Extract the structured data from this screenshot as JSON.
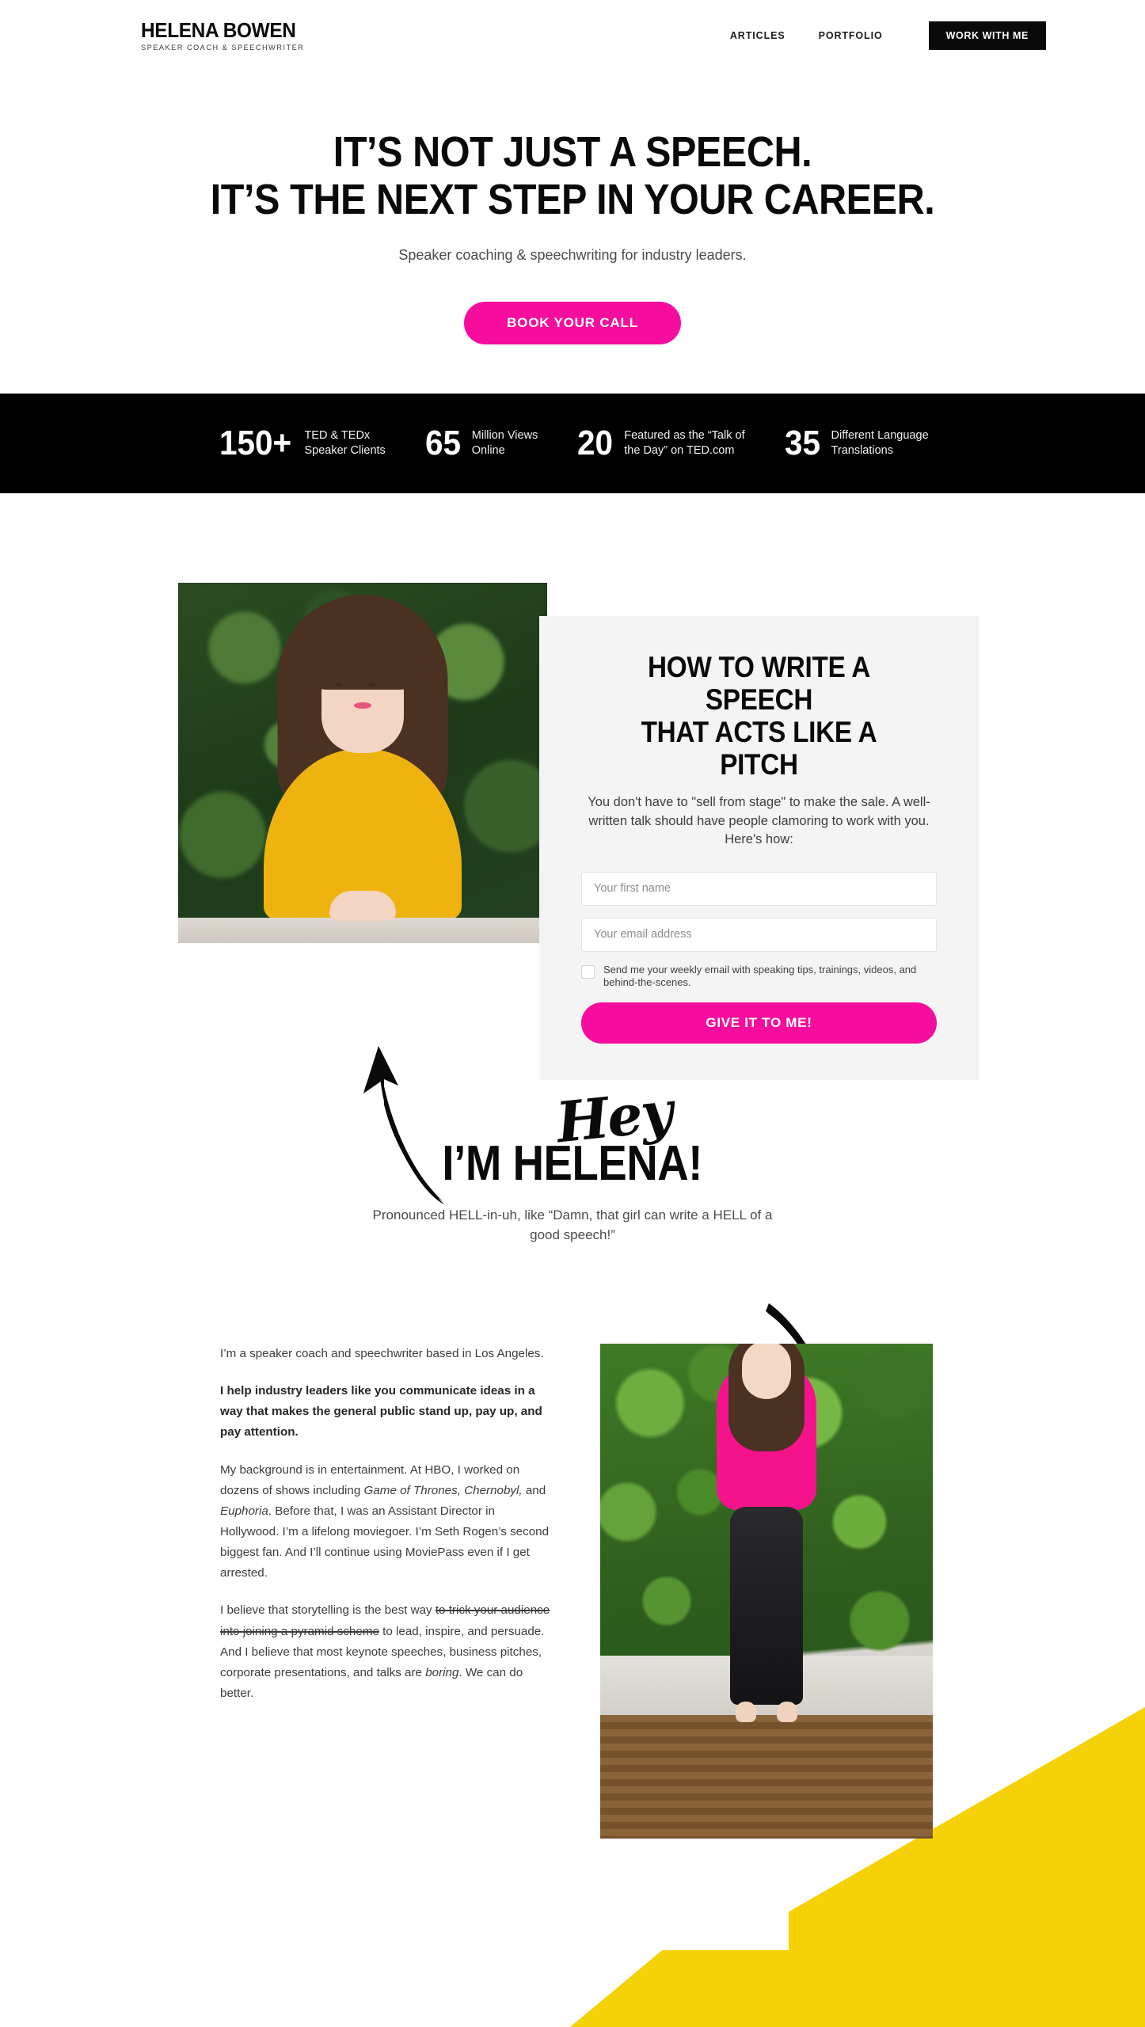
{
  "header": {
    "logo_name": "HELENA BOWEN",
    "logo_tagline": "SPEAKER COACH & SPEECHWRITER",
    "nav": [
      {
        "label": "ARTICLES"
      },
      {
        "label": "PORTFOLIO"
      }
    ],
    "cta_label": "WORK WITH ME"
  },
  "hero": {
    "headline_line1": "IT’S NOT JUST A SPEECH.",
    "headline_line2": "IT’S THE NEXT STEP IN YOUR CAREER.",
    "subheadline": "Speaker coaching & speechwriting for industry leaders.",
    "cta_label": "BOOK YOUR CALL"
  },
  "stats": [
    {
      "number": "150+",
      "label_line1": "TED & TEDx",
      "label_line2": "Speaker Clients"
    },
    {
      "number": "65",
      "label_line1": "Million Views",
      "label_line2": "Online"
    },
    {
      "number": "20",
      "label_line1": "Featured as the “Talk of",
      "label_line2": "the Day” on TED.com"
    },
    {
      "number": "35",
      "label_line1": "Different Language",
      "label_line2": "Translations"
    }
  ],
  "optin": {
    "heading_line1": "HOW TO WRITE A SPEECH",
    "heading_line2": "THAT ACTS LIKE A PITCH",
    "description": "You don't have to \"sell from stage\" to make the sale. A well-written talk should have people clamoring to work with you. Here's how:",
    "first_name_placeholder": "Your first name",
    "email_placeholder": "Your email address",
    "checkbox_label": "Send me your weekly email with speaking tips, trainings, videos, and behind-the-scenes.",
    "submit_label": "GIVE IT TO ME!"
  },
  "intro": {
    "script_word": "Hey",
    "headline": "I’M HELENA!",
    "pronunciation": "Pronounced HELL-in-uh, like “Damn, that girl can write a HELL of a good speech!”"
  },
  "bio": {
    "p1": "I’m a speaker coach and speechwriter based in Los Angeles.",
    "p2": "I help industry leaders like you communicate ideas in a way that makes the general public stand up, pay up, and pay attention.",
    "p3_a": "My background is in entertainment. At HBO, I worked on dozens of shows including ",
    "p3_em1": "Game of Thrones, Chernobyl,",
    "p3_b": " and ",
    "p3_em2": "Euphoria",
    "p3_c": ". Before that, I was an Assistant Director in Hollywood. I’m a lifelong moviegoer. I’m Seth Rogen’s second biggest fan. And I’ll continue using MoviePass even if I get arrested.",
    "p4_a": "I believe that storytelling is the best way ",
    "p4_strike": "to trick your audience into joining a pyramid scheme",
    "p4_b": " to lead, inspire, and persuade. And I believe that most keynote speeches, business pitches, corporate presentations, and talks are ",
    "p4_em": "boring",
    "p4_c": ". We can do better."
  },
  "colors": {
    "pink": "#F70D9E",
    "yellow": "#F5D207",
    "black": "#000000",
    "card_gray": "#F4F4F4"
  }
}
